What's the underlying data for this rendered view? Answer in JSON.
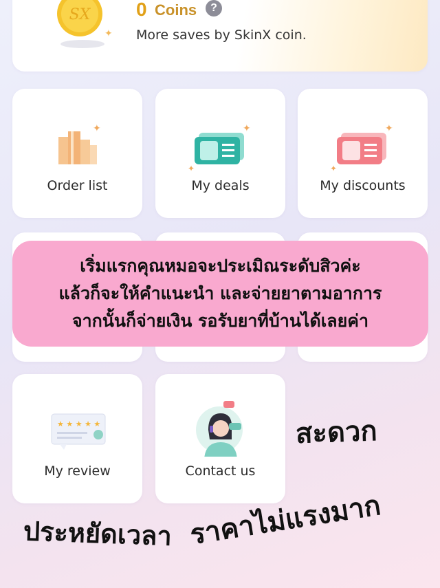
{
  "coins": {
    "count": "0",
    "label": "Coins",
    "help_symbol": "?",
    "description": "More saves by SkinX coin.",
    "coin_mark": "SX"
  },
  "tiles": [
    {
      "label": "Order list",
      "icon": "boxes-icon"
    },
    {
      "label": "My deals",
      "icon": "ticket-icon"
    },
    {
      "label": "My discounts",
      "icon": "coupon-icon"
    },
    {
      "label": "My review",
      "icon": "review-stars-icon"
    },
    {
      "label": "Contact us",
      "icon": "support-agent-icon"
    }
  ],
  "banner": {
    "lines": [
      "เริ่มแรกคุณหมอจะประเมิณระดับสิวค่ะ",
      "แล้วก็จะให้คำแนะนำ และจ่ายยาตามอาการ",
      "จากนั้นก็จ่ายเงิน รอรับยาที่บ้านได้เลยค่า"
    ]
  },
  "handwritten": {
    "convenient": "สะดวก",
    "save_time": "ประหยัดเวลา",
    "not_expensive": "ราคาไม่แรงมาก"
  },
  "colors": {
    "coin_gold": "#e1a119",
    "banner_pink": "#f9a9cf",
    "teal": "#2fb3a3",
    "coral": "#f27d86"
  }
}
